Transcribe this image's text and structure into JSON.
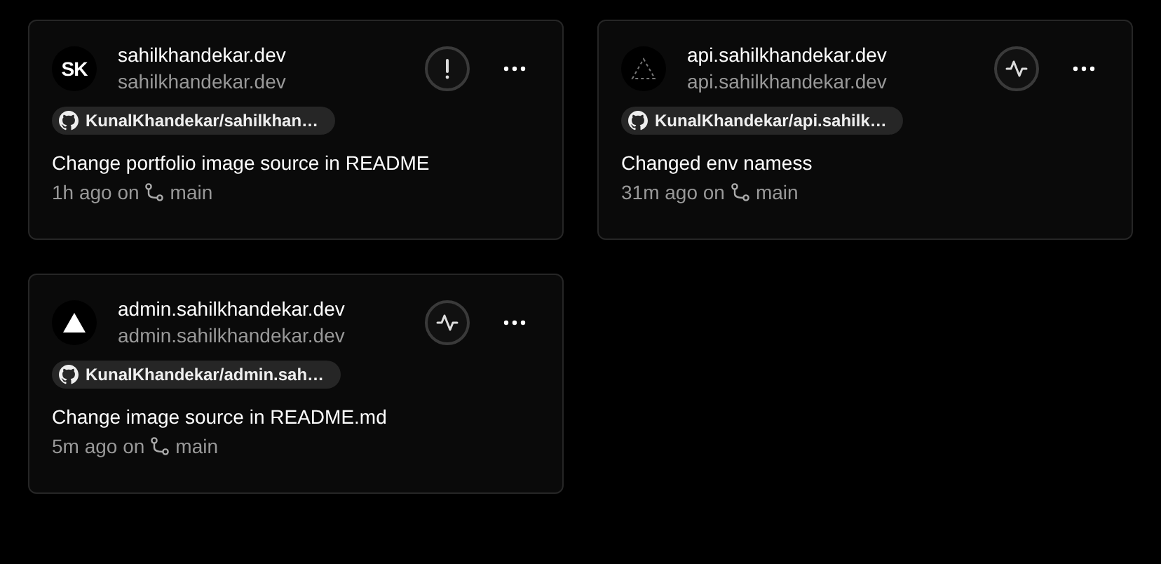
{
  "projects": [
    {
      "avatar": {
        "kind": "text",
        "text": "SK"
      },
      "name": "sahilkhandekar.dev",
      "domain": "sahilkhandekar.dev",
      "status_icon": {
        "kind": "warning"
      },
      "repo": "KunalKhandekar/sahilkhan…",
      "commit": "Change portfolio image source in README",
      "time": "1h ago on",
      "branch": "main"
    },
    {
      "avatar": {
        "kind": "outline-triangle"
      },
      "name": "api.sahilkhandekar.dev",
      "domain": "api.sahilkhandekar.dev",
      "status_icon": {
        "kind": "activity"
      },
      "repo": "KunalKhandekar/api.sahilk…",
      "commit": "Changed env namess",
      "time": "31m ago on",
      "branch": "main"
    },
    {
      "avatar": {
        "kind": "solid-triangle"
      },
      "name": "admin.sahilkhandekar.dev",
      "domain": "admin.sahilkhandekar.dev",
      "status_icon": {
        "kind": "activity"
      },
      "repo": "KunalKhandekar/admin.sah…",
      "commit": "Change image source in README.md",
      "time": "5m ago on",
      "branch": "main"
    }
  ]
}
